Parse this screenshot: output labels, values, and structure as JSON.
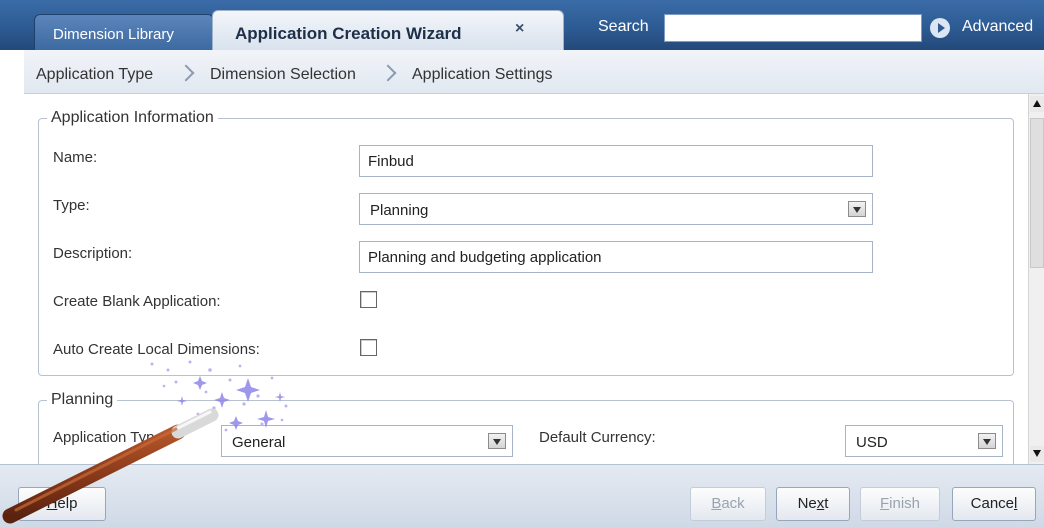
{
  "tabs": {
    "dimension_library": "Dimension Library",
    "wizard": "Application Creation Wizard",
    "close_glyph": "×"
  },
  "search": {
    "label": "Search",
    "value": "",
    "advanced_label": "Advanced"
  },
  "breadcrumb": [
    "Application Type",
    "Dimension Selection",
    "Application Settings"
  ],
  "app_info": {
    "legend": "Application Information",
    "name_label": "Name:",
    "name_value": "Finbud",
    "type_label": "Type:",
    "type_value": "Planning",
    "description_label": "Description:",
    "description_value": "Planning and budgeting application",
    "blank_label": "Create Blank Application:",
    "blank_checked": false,
    "auto_label": "Auto Create Local Dimensions:",
    "auto_checked": false
  },
  "planning": {
    "legend": "Planning",
    "app_type_label": "Application Type:",
    "app_type_value": "General",
    "currency_label": "Default Currency:",
    "currency_value": "USD"
  },
  "footer": {
    "help": {
      "mnemonic": "H",
      "rest": "elp"
    },
    "back": {
      "mnemonic": "B",
      "rest": "ack"
    },
    "next": {
      "pre": "Ne",
      "mnemonic": "x",
      "post": "t"
    },
    "finish": {
      "mnemonic": "F",
      "rest": "inish"
    },
    "cancel": {
      "pre": "Cance",
      "mnemonic": "l"
    }
  },
  "colors": {
    "topbar": "#2d5b93",
    "wand_handle": "#8b3a1a",
    "wand_tip": "#d9d9d9",
    "sparkle": "#8e86e8"
  }
}
